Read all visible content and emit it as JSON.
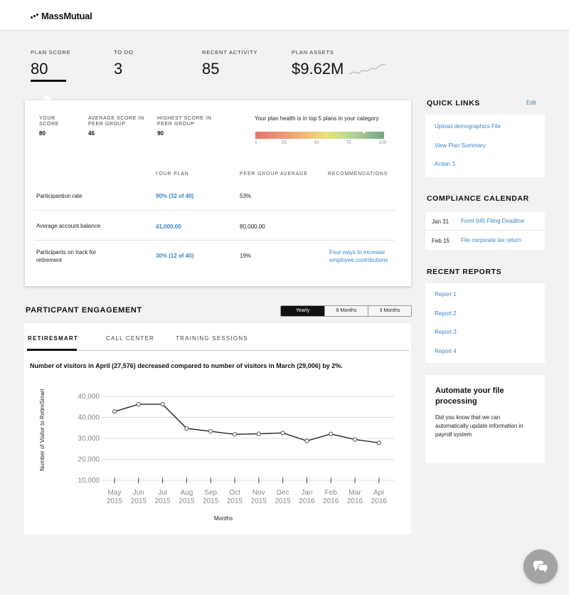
{
  "brand": {
    "name": "MassMutual"
  },
  "stats": [
    {
      "label": "PLAN SCORE",
      "value": "80"
    },
    {
      "label": "TO DO",
      "value": "3"
    },
    {
      "label": "RECENT ACTIVITY",
      "value": "85"
    },
    {
      "label": "PLAN ASSETS",
      "value": "$9.62M"
    }
  ],
  "score_card": {
    "your_score_label": "YOUR SCORE",
    "your_score": "80",
    "avg_label": "AVERAGE SCORE IN PEER GROUP",
    "avg_score": "46",
    "highest_label": "HIGHEST SCORE IN PEER GROUP",
    "highest_score": "90",
    "health_text": "Your plan health is in top 5 plans in your category",
    "health_ticks": [
      "0",
      "25",
      "50",
      "75",
      "100"
    ],
    "health_level": 85,
    "columns": [
      "YOUR PLAN",
      "PEER GROUP AVERAGE",
      "RECOMMENDATIONS"
    ],
    "rows": [
      {
        "metric": "Participantion rate",
        "your_plan": "90% (32 of 40)",
        "peer_avg": "53%",
        "recommendation": ""
      },
      {
        "metric": "Average account balance",
        "your_plan": "41,000.00",
        "peer_avg": "80,000.00",
        "recommendation": ""
      },
      {
        "metric": "Participants on track for retirement",
        "your_plan": "30% (12 of 40)",
        "peer_avg": "19%",
        "recommendation": "Four ways to increase employee contributions"
      }
    ]
  },
  "engagement": {
    "title": "PARTICPANT ENGAGEMENT",
    "periods": [
      "Yearly",
      "6 Months",
      "3 Months"
    ],
    "selected_period": "Yearly",
    "tabs": [
      "RETIRESMART",
      "CALL CENTER",
      "TRAINING SESSIONS"
    ],
    "active_tab": "RETIRESMART",
    "summary": "Number of visitors in April (27,576) decreased compared to number of visitors in March (29,006) by 2%."
  },
  "chart_data": {
    "type": "line",
    "categories": [
      "May 2015",
      "Jun 2015",
      "Jul 2015",
      "Aug 2015",
      "Sep 2015",
      "Oct 2015",
      "Nov 2015",
      "Dec 2015",
      "Jan 2016",
      "Feb 2016",
      "Mar 2016",
      "Apr 2016"
    ],
    "x_month": [
      "May",
      "Jun",
      "Jul",
      "Aug",
      "Sep",
      "Oct",
      "Nov",
      "Dec",
      "Jan",
      "Feb",
      "Mar",
      "Apr"
    ],
    "x_year": [
      "2015",
      "2015",
      "2015",
      "2015",
      "2015",
      "2015",
      "2015",
      "2015",
      "2016",
      "2016",
      "2016",
      "2016"
    ],
    "values": [
      41500,
      45600,
      45600,
      32000,
      30400,
      28700,
      29000,
      29500,
      25000,
      28900,
      25800,
      23900
    ],
    "y_tick_labels": [
      "40,000",
      "40,000",
      "30,000",
      "20,000",
      "10,000"
    ],
    "ylim": [
      0,
      50000
    ],
    "xlabel": "Months",
    "ylabel": "Number of Visitor to RetireSmart",
    "grid": true,
    "color": "#111111"
  },
  "quick_links": {
    "title": "QUICK LINKS",
    "edit": "Edit",
    "items": [
      "Upload demographics File",
      "View Plan Summary",
      "Action 3"
    ]
  },
  "compliance": {
    "title": "COMPLIANCE CALENDAR",
    "items": [
      {
        "date": "Jan 31",
        "label": "Form 945 Filing Deadline"
      },
      {
        "date": "Feb 15",
        "label": "File corporate tax return"
      }
    ]
  },
  "reports": {
    "title": "RECENT REPORTS",
    "items": [
      "Report 1",
      "Report 2",
      "Report 3",
      "Report 4"
    ]
  },
  "automate": {
    "title": "Automate your file processing",
    "body": "Did you know that we can automatically update information in payroll system"
  },
  "colors": {
    "link": "#3a86c8",
    "accent": "#111111",
    "chat": "#a3a3a3"
  },
  "icons": {
    "chat": "chat-bubbles-icon"
  }
}
